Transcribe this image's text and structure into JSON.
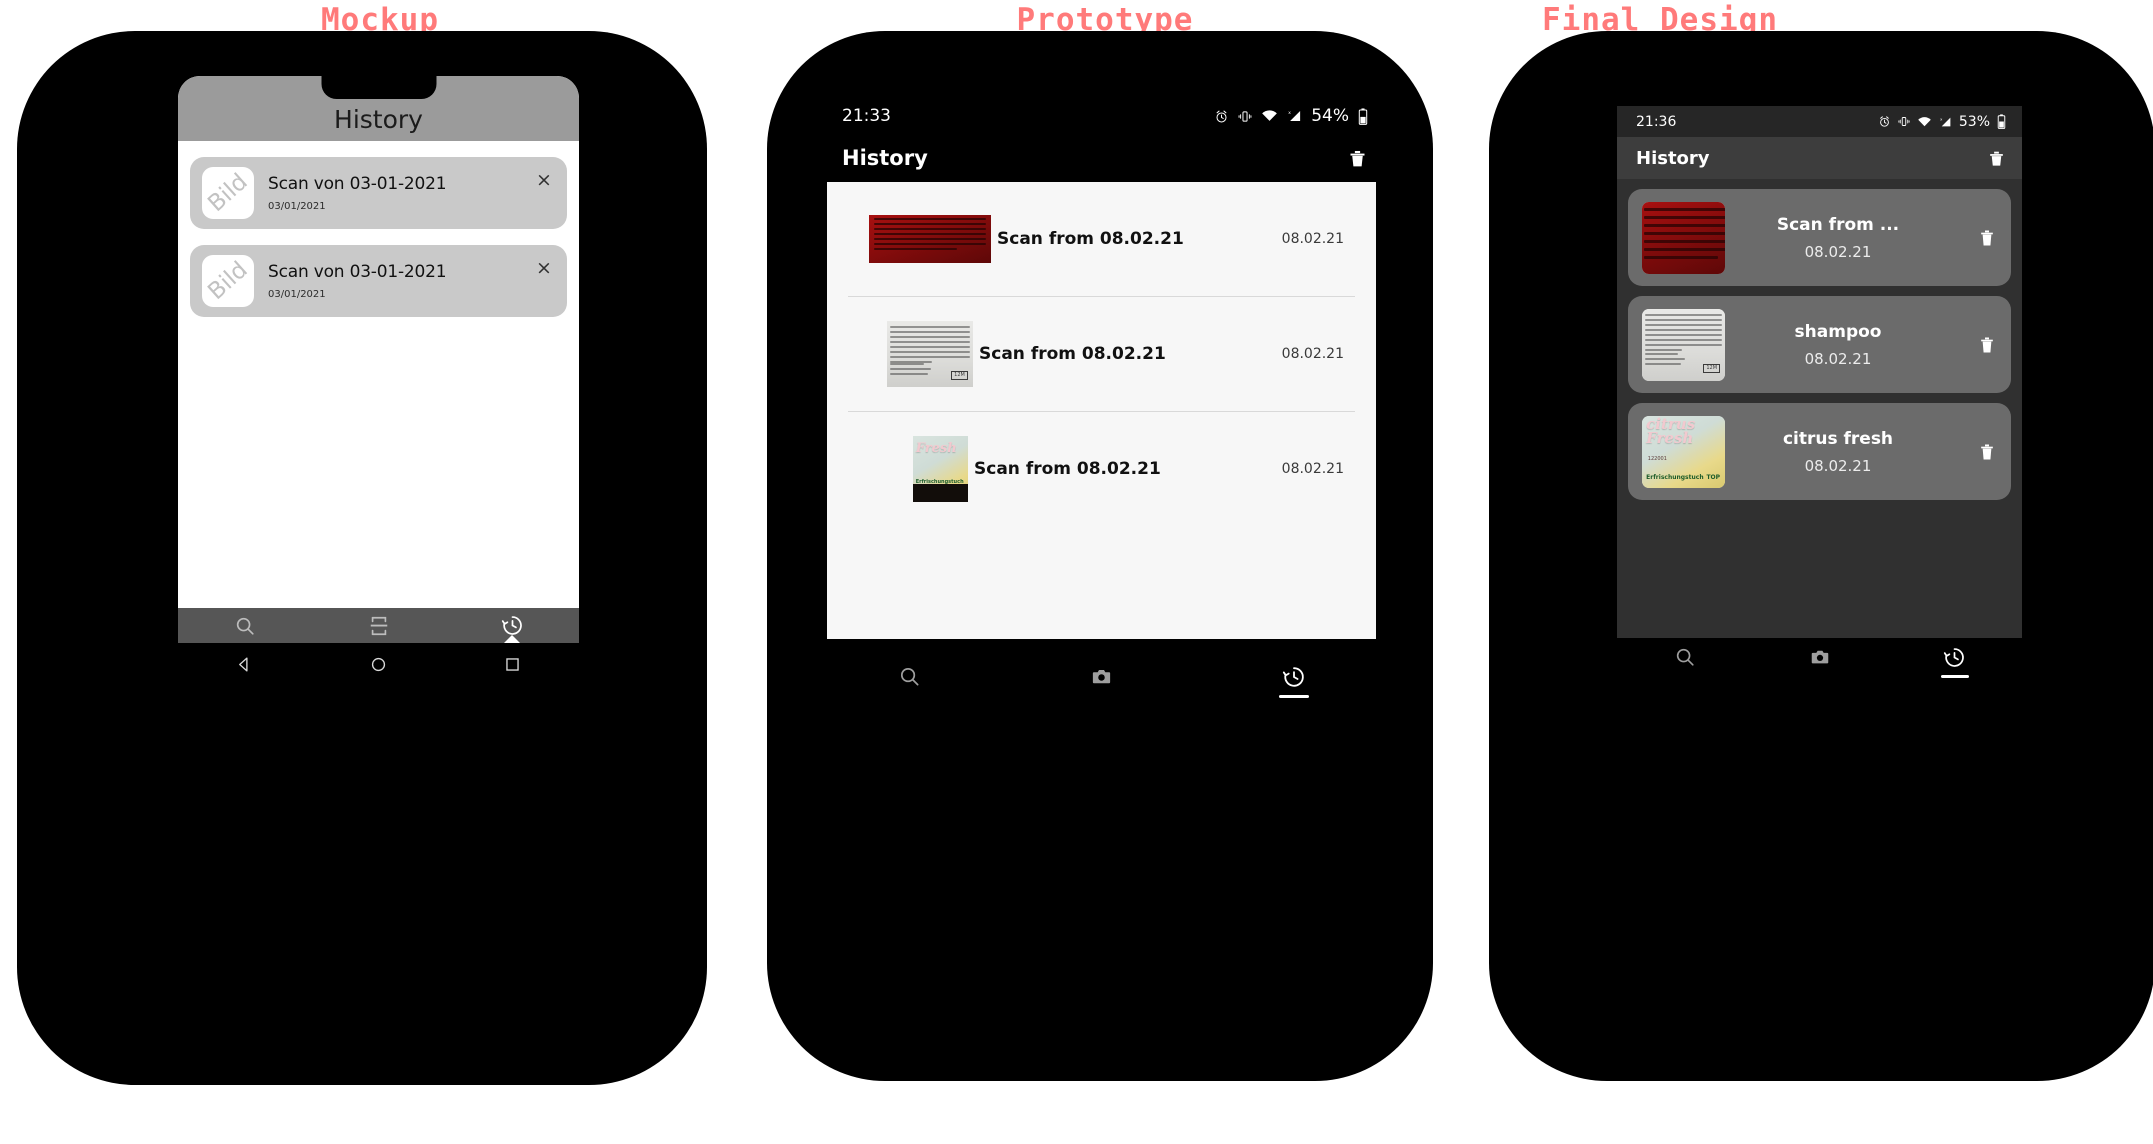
{
  "panels": {
    "mockup": {
      "label": "Mockup",
      "appbar_title": "History",
      "cards": [
        {
          "thumb_text": "Bild",
          "title": "Scan von 03-01-2021",
          "date": "03/01/2021",
          "close_glyph": "×"
        },
        {
          "thumb_text": "Bild",
          "title": "Scan von 03-01-2021",
          "date": "03/01/2021",
          "close_glyph": "×"
        }
      ],
      "tabs": [
        {
          "name": "search",
          "icon": "search-icon",
          "active": false
        },
        {
          "name": "scan",
          "icon": "scan-frame-icon",
          "active": false
        },
        {
          "name": "history",
          "icon": "history-icon",
          "active": true
        }
      ],
      "system_nav": [
        {
          "name": "back",
          "icon": "triangle-back-icon"
        },
        {
          "name": "home",
          "icon": "circle-home-icon"
        },
        {
          "name": "recents",
          "icon": "square-recents-icon"
        }
      ]
    },
    "prototype": {
      "label": "Prototype",
      "status": {
        "time": "21:33",
        "battery_percent": "54%",
        "icons": [
          "alarm-icon",
          "vibrate-icon",
          "wifi-icon",
          "signal-icon",
          "battery-icon"
        ]
      },
      "appbar_title": "History",
      "appbar_action": "delete-all-icon",
      "rows": [
        {
          "art": "red",
          "title": "Scan from 08.02.21",
          "date": "08.02.21"
        },
        {
          "art": "label",
          "title": "Scan from 08.02.21",
          "date": "08.02.21"
        },
        {
          "art": "citrus",
          "title": "Scan from 08.02.21",
          "date": "08.02.21"
        }
      ],
      "tabs": [
        {
          "name": "search",
          "icon": "search-icon",
          "active": false
        },
        {
          "name": "camera",
          "icon": "camera-icon",
          "active": false
        },
        {
          "name": "history",
          "icon": "history-icon",
          "active": true
        }
      ]
    },
    "final": {
      "label": "Final Design",
      "status": {
        "time": "21:36",
        "battery_percent": "53%",
        "icons": [
          "alarm-icon",
          "vibrate-icon",
          "wifi-icon",
          "signal-icon",
          "battery-icon"
        ]
      },
      "appbar_title": "History",
      "appbar_action": "delete-all-icon",
      "cards": [
        {
          "art": "red",
          "title": "Scan from ...",
          "date": "08.02.21",
          "delete": "delete-icon"
        },
        {
          "art": "label",
          "title": "shampoo",
          "date": "08.02.21",
          "delete": "delete-icon"
        },
        {
          "art": "citrus",
          "title": "citrus fresh",
          "date": "08.02.21",
          "delete": "delete-icon"
        }
      ],
      "tabs": [
        {
          "name": "search",
          "icon": "search-icon",
          "active": false
        },
        {
          "name": "camera",
          "icon": "camera-icon",
          "active": false
        },
        {
          "name": "history",
          "icon": "history-icon",
          "active": true
        }
      ]
    }
  },
  "thumb_art": {
    "red_lines": [
      "INGREDIENTS: AQUA - SODIUM LAURETH SULFATE",
      "COCAMIDOPROPYL BETAINE - GLYCERIN - SODIUM",
      "CHLORIDE - PARFUM - SODIUM BENZOATE - CITRIC ACID",
      "STYRENE/ACRYLATES COPOLYMER - COCO-GLUCOSIDE",
      "GLYCERYL OLEATE - POTASSIUM SORBATE - ALCOHOL",
      "POLYQUATERNIUM-10 - SODIUM LAURYL SULFATE",
      "RHEUM RHAPONTICUM ROOT EXTRACT"
    ],
    "label_lines": [
      "INGREDIENTS: Aqua (Water), Sodium Laureth",
      "Sulfate, Glycerin, Cocamidopropyl Betaine,",
      "Sodium Chloride, Parfum (Fragrance), Glycol",
      "Distearate, Coco-Glucoside, Citric Acid, Sodium",
      "Benzoate, Cocamide MEA, Laureth-10,",
      "Potassium Sorbate, Argan Oil Glycereth-8 Ester,",
      "Hydroxypropyl Guar Hydroxypropyltrimonium",
      "Chloride, Phenoxyethanol."
    ],
    "label_footer": [
      "Hergestellt in der EU",
      "Nerdtec, Floriansbogen 2-4,",
      "82061 Neuried, Deutschland"
    ],
    "label_badge": "12M",
    "citrus_word_1": "citrus",
    "citrus_word_2": "Fresh",
    "citrus_code": "122001",
    "citrus_footer": "Erfrischungstuch",
    "citrus_brand": "TOP"
  },
  "colors": {
    "title_accent": "#ff7a7a",
    "phone_body": "#000000",
    "mockup_appbar": "#9b9b9b",
    "mockup_card": "#c9c9c9",
    "mockup_tabbar": "#565656",
    "proto_content": "#f7f7f7",
    "final_bg": "#303030",
    "final_appbar": "#3d3d3d",
    "final_card": "#6b6b6b",
    "final_statusbar": "#262626"
  }
}
